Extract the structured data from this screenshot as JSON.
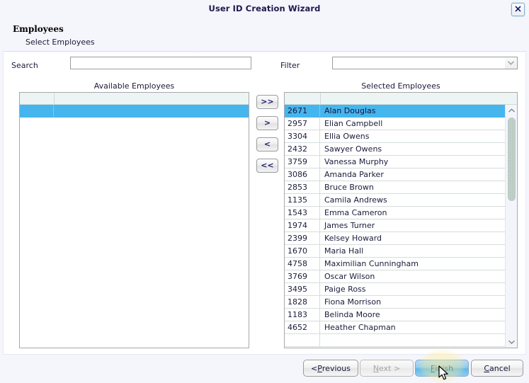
{
  "window": {
    "title": "User ID Creation Wizard",
    "close_icon": "close-x-icon"
  },
  "header": {
    "step_title": "Employees",
    "step_subtitle": "Select Employees"
  },
  "search": {
    "label": "Search",
    "value": "",
    "placeholder": ""
  },
  "filter": {
    "label": "Filter",
    "value": "",
    "chevron_icon": "chevron-down-icon"
  },
  "available": {
    "caption": "Available Employees",
    "columns": [
      "",
      ""
    ],
    "rows": [
      {
        "id": "",
        "name": "",
        "selected": true
      }
    ]
  },
  "selected": {
    "caption": "Selected Employees",
    "columns": [
      "",
      ""
    ],
    "rows": [
      {
        "id": "2671",
        "name": "Alan Douglas",
        "selected": true
      },
      {
        "id": "2957",
        "name": "Elian Campbell",
        "selected": false
      },
      {
        "id": "3304",
        "name": "Ellia Owens",
        "selected": false
      },
      {
        "id": "2432",
        "name": "Sawyer Owens",
        "selected": false
      },
      {
        "id": "3759",
        "name": "Vanessa Murphy",
        "selected": false
      },
      {
        "id": "3086",
        "name": "Amanda Parker",
        "selected": false
      },
      {
        "id": "2853",
        "name": "Bruce Brown",
        "selected": false
      },
      {
        "id": "1135",
        "name": "Camila Andrews",
        "selected": false
      },
      {
        "id": "1543",
        "name": "Emma Cameron",
        "selected": false
      },
      {
        "id": "1974",
        "name": "James Turner",
        "selected": false
      },
      {
        "id": "2399",
        "name": "Kelsey Howard",
        "selected": false
      },
      {
        "id": "1670",
        "name": "Maria Hall",
        "selected": false
      },
      {
        "id": "4758",
        "name": "Maximilian Cunningham",
        "selected": false
      },
      {
        "id": "3769",
        "name": "Oscar Wilson",
        "selected": false
      },
      {
        "id": "3495",
        "name": "Paige Ross",
        "selected": false
      },
      {
        "id": "1828",
        "name": "Fiona Morrison",
        "selected": false
      },
      {
        "id": "1183",
        "name": "Belinda Moore",
        "selected": false
      },
      {
        "id": "4652",
        "name": "Heather Chapman",
        "selected": false
      },
      {
        "id": "",
        "name": "",
        "selected": false
      }
    ],
    "scrollbar": {
      "up_icon": "chevron-up-icon",
      "down_icon": "chevron-down-icon"
    }
  },
  "transfer_buttons": [
    {
      "id": "move-all-right",
      "label": ">>"
    },
    {
      "id": "move-right",
      "label": ">"
    },
    {
      "id": "move-left",
      "label": "<"
    },
    {
      "id": "move-all-left",
      "label": "<<"
    }
  ],
  "footer": {
    "previous": {
      "pre": "< ",
      "mnemonic": "P",
      "post": "revious",
      "enabled": true
    },
    "next": {
      "pre": "",
      "mnemonic": "N",
      "post": "ext >",
      "enabled": false
    },
    "finish": {
      "pre": "",
      "mnemonic": "F",
      "post": "inish",
      "enabled": true
    },
    "cancel": {
      "pre": "",
      "mnemonic": "C",
      "post": "ancel",
      "enabled": true
    }
  },
  "colors": {
    "page_background": "#f5f5fc",
    "panel_background": "#ffffff",
    "selection_blue": "#45b5ee",
    "title_text": "#1a1a4e",
    "finish_highlight": "#8ecbf0",
    "click_ripple": "#ffec96"
  }
}
